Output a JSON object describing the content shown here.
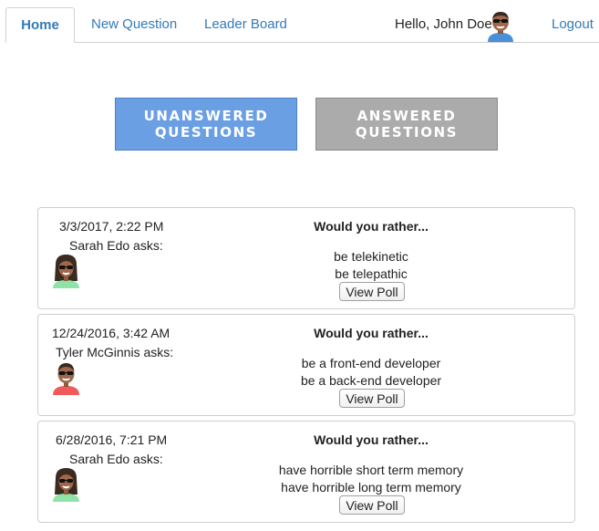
{
  "nav": {
    "home": "Home",
    "new_question": "New Question",
    "leader_board": "Leader Board",
    "greeting": "Hello, John Doe",
    "logout": "Logout",
    "user_avatar": "avatar-man-sunglasses-blue"
  },
  "toggle": {
    "unanswered": "UNANSWERED\nQUESTIONS",
    "answered": "ANSWERED\nQUESTIONS",
    "active": "unanswered"
  },
  "questions": [
    {
      "date": "3/3/2017, 2:22 PM",
      "asker": "Sarah Edo asks:",
      "avatar": "avatar-woman-sunglasses-green",
      "heading": "Would you rather...",
      "option_one": "be telekinetic",
      "option_two": "be telepathic",
      "button": "View Poll"
    },
    {
      "date": "12/24/2016, 3:42 AM",
      "asker": "Tyler McGinnis asks:",
      "avatar": "avatar-man-sunglasses-red",
      "heading": "Would you rather...",
      "option_one": "be a front-end developer",
      "option_two": "be a back-end developer",
      "button": "View Poll"
    },
    {
      "date": "6/28/2016, 7:21 PM",
      "asker": "Sarah Edo asks:",
      "avatar": "avatar-woman-sunglasses-green",
      "heading": "Would you rather...",
      "option_one": "have horrible short term memory",
      "option_two": "have horrible long term memory",
      "button": "View Poll"
    }
  ],
  "colors": {
    "link": "#337ab7",
    "active_toggle": "#6b9fe4",
    "inactive_toggle": "#ababab"
  }
}
